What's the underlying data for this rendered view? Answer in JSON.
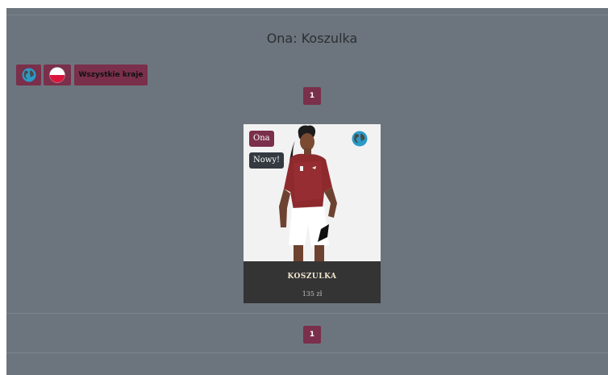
{
  "page": {
    "title": "Ona: Koszulka"
  },
  "filters": {
    "all_countries_label": "Wszystkie kraje",
    "world_icon": "globe-icon",
    "poland_icon": "poland-flag-icon"
  },
  "pagination": {
    "top_page": "1",
    "bottom_page": "1"
  },
  "product": {
    "name": "KOSZULKA",
    "price": "135 zł",
    "badge_gender": "Ona",
    "badge_new": "Nowy!",
    "corner_icon": "globe-icon"
  },
  "colors": {
    "background": "#6c757d",
    "accent": "#7a2f4a",
    "card": "#343434"
  }
}
